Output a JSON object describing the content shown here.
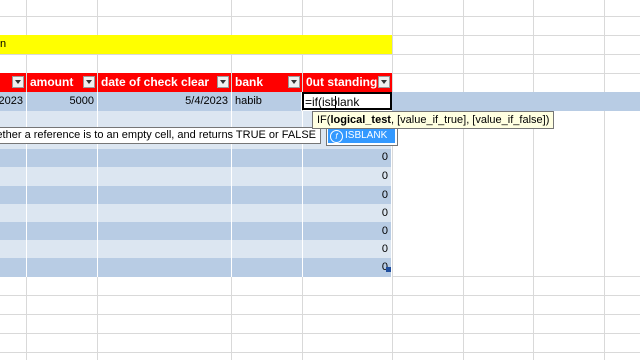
{
  "sheet": {
    "title_fragment": "n",
    "headers": [
      {
        "label": "",
        "name": "col-prev"
      },
      {
        "label": "amount",
        "name": "col-amount"
      },
      {
        "label": "date of check clear",
        "name": "col-date-check-clear"
      },
      {
        "label": "bank",
        "name": "col-bank"
      },
      {
        "label": "0ut standing",
        "name": "col-outstanding"
      }
    ],
    "row1": {
      "prev": "2023",
      "amount": "5000",
      "date_clear": "5/4/2023",
      "bank": "habib"
    },
    "outstanding_values": [
      "0",
      "0",
      "0",
      "0",
      "0",
      "0",
      "0"
    ]
  },
  "editor": {
    "formula_text": "=if(isblank"
  },
  "tooltip": {
    "signature_fn": "IF(",
    "signature_bold": "logical_test",
    "signature_rest": ", [value_if_true], [value_if_false])"
  },
  "description_tip": "whether a reference is to an empty cell, and returns TRUE or FALSE",
  "autocomplete": {
    "icon": "function-icon",
    "items": [
      "ISBLANK"
    ]
  },
  "colors": {
    "header_bg": "#ff0000",
    "title_band": "#ffff00",
    "band_dark": "#b8cce4",
    "band_light": "#dce6f1",
    "selection": "#3399ff"
  }
}
